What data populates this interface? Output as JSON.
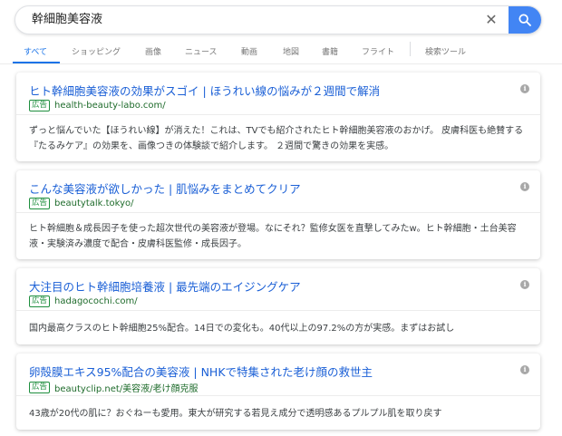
{
  "search": {
    "query": "幹細胞美容液",
    "clear_symbol": "✕"
  },
  "tabs": [
    {
      "label": "すべて"
    },
    {
      "label": "ショッピング"
    },
    {
      "label": "画像"
    },
    {
      "label": "ニュース"
    },
    {
      "label": "動画"
    },
    {
      "label": "地図"
    },
    {
      "label": "書籍"
    },
    {
      "label": "フライト"
    },
    {
      "label": "検索ツール"
    }
  ],
  "ads": [
    {
      "title": "ヒト幹細胞美容液の効果がスゴイ | ほうれい線の悩みが２週間で解消",
      "badge": "広告",
      "url": "health-beauty-labo.com/",
      "description": "ずっと悩んでいた【ほうれい線】が消えた！これは、TVでも紹介されたヒト幹細胞美容液のおかげ。 皮膚科医も絶賛する『たるみケア』の効果を、画像つきの体験談で紹介します。 ２週間で驚きの効果を実感。"
    },
    {
      "title": "こんな美容液が欲しかった | 肌悩みをまとめてクリア",
      "badge": "広告",
      "url": "beautytalk.tokyo/",
      "description": "ヒト幹細胞＆成長因子を使った超次世代の美容液が登場。なにそれ？監修女医を直撃してみたw。ヒト幹細胞・土台美容液・実験済み濃度で配合・皮膚科医監修・成長因子。"
    },
    {
      "title": "大注目のヒト幹細胞培養液 | 最先端のエイジングケア",
      "badge": "広告",
      "url": "hadagocochi.com/",
      "description": "国内最高クラスのヒト幹細胞25%配合。14日での変化も。40代以上の97.2%の方が実感。まずはお試し"
    },
    {
      "title": "卵殻膜エキス95%配合の美容液 | NHKで特集された老け顔の救世主",
      "badge": "広告",
      "url": "beautyclip.net/美容液/老け顔克服",
      "description": "43歳が20代の肌に？おぐねーも愛用。東大が研究する若見え成分で透明感あるプルプル肌を取り戻す"
    }
  ],
  "colors": {
    "accent": "#1a73e8",
    "link": "#1a5fd6",
    "url_green": "#1e6b2b",
    "search_button": "#4285f4"
  },
  "icons": {
    "search_button": "search-icon",
    "clear_button": "close-icon",
    "ad_info": "info-icon"
  }
}
